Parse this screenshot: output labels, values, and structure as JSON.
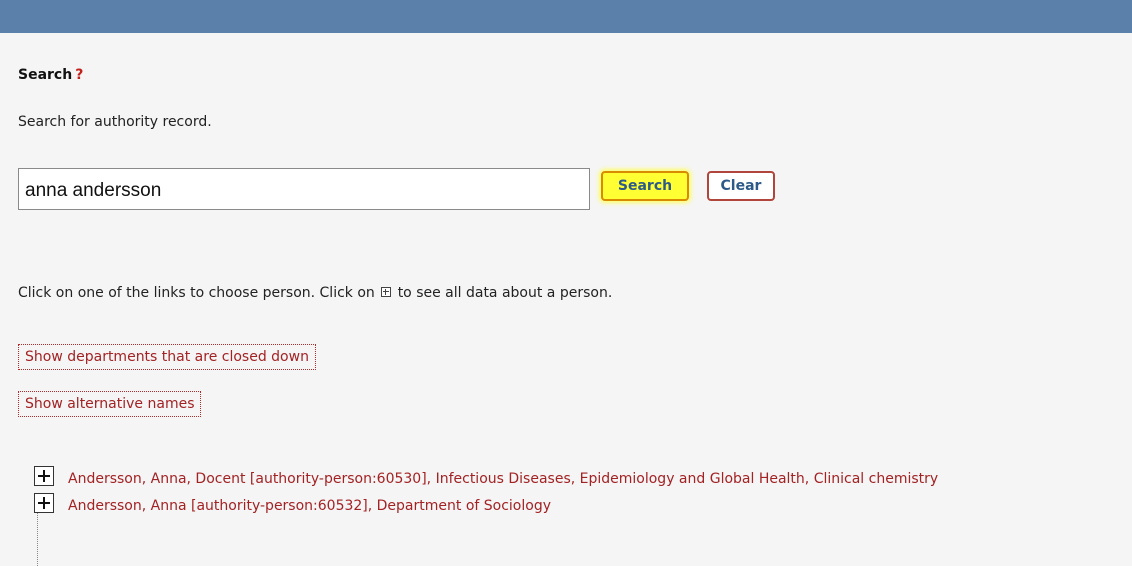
{
  "search": {
    "heading": "Search",
    "help_mark": "?",
    "intro": "Search for authority record.",
    "query": "anna andersson",
    "search_button": "Search",
    "clear_button": "Clear"
  },
  "instruction": {
    "before": "Click on one of the links to choose person. Click on",
    "after": "to see all data about a person."
  },
  "toggles": {
    "closed_departments": "Show departments that are closed down",
    "alternative_names": "Show alternative names"
  },
  "results": [
    {
      "label": "Andersson, Anna, Docent [authority-person:60530], Infectious Diseases, Epidemiology and Global Health, Clinical chemistry",
      "icon": "expand-plus-icon"
    },
    {
      "label": "Andersson, Anna [authority-person:60532], Department of Sociology",
      "icon": "expand-plus-icon"
    }
  ],
  "colors": {
    "top_bar": "#5b80a9",
    "panel_background": "#f5f5f5",
    "link": "#a32224",
    "button_text": "#2d5a88",
    "search_highlight": "#ffff33"
  }
}
